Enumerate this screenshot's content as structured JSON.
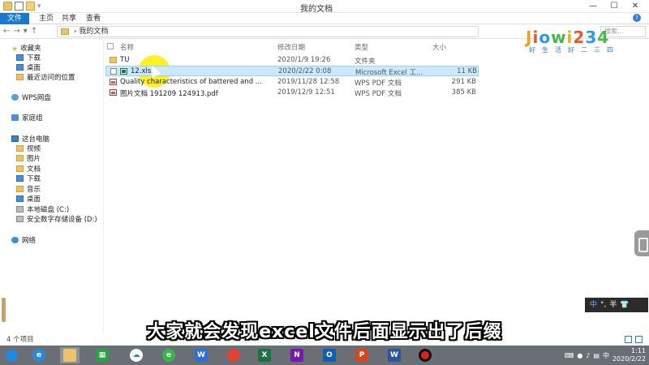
{
  "window": {
    "title": "我的文档",
    "controls": [
      "—",
      "☐",
      "✕"
    ]
  },
  "ribbon": {
    "tabs": [
      "文件",
      "主页",
      "共享",
      "查看"
    ]
  },
  "address": {
    "path": "我的文档",
    "search_placeholder": "搜索..."
  },
  "sidebar": {
    "favorites_header": "收藏夹",
    "favorites": [
      "下载",
      "桌面",
      "最近访问的位置"
    ],
    "wps": "WPS网盘",
    "homegroup": "家庭组",
    "pc_header": "这台电脑",
    "pc_items": [
      "视频",
      "图片",
      "文档",
      "下载",
      "音乐",
      "桌面",
      "本地磁盘 (C:)",
      "安全数字存储设备 (D:)"
    ],
    "network": "网络"
  },
  "columns": [
    "名称",
    "修改日期",
    "类型",
    "大小"
  ],
  "files": [
    {
      "name": "TU",
      "date": "2020/1/9 19:26",
      "type": "文件夹",
      "size": "",
      "kind": "folder"
    },
    {
      "name": "12.xlsx",
      "date": "2020/2/22 0:08",
      "type": "Microsoft Excel 工...",
      "size": "11 KB",
      "kind": "xlsx"
    },
    {
      "name": "Quality characteristics of battered and ...",
      "date": "2019/11/28 12:58",
      "type": "WPS PDF 文档",
      "size": "291 KB",
      "kind": "pdf"
    },
    {
      "name": "图片文档 191209 124913.pdf",
      "date": "2019/12/9 12:51",
      "type": "WPS PDF 文档",
      "size": "385 KB",
      "kind": "pdf"
    }
  ],
  "status": {
    "count": "4 个项目"
  },
  "logo": {
    "brand": "Jiowi234",
    "tagline": "好生活好二三四"
  },
  "ime": {
    "lang": "中",
    "mode": "°,",
    "width": "半"
  },
  "subtitle": "大家就会发现excel文件后面显示出了后缀",
  "taskbar": {
    "time": "1:11",
    "date": "2020/2/22",
    "ime_lang": "中"
  }
}
